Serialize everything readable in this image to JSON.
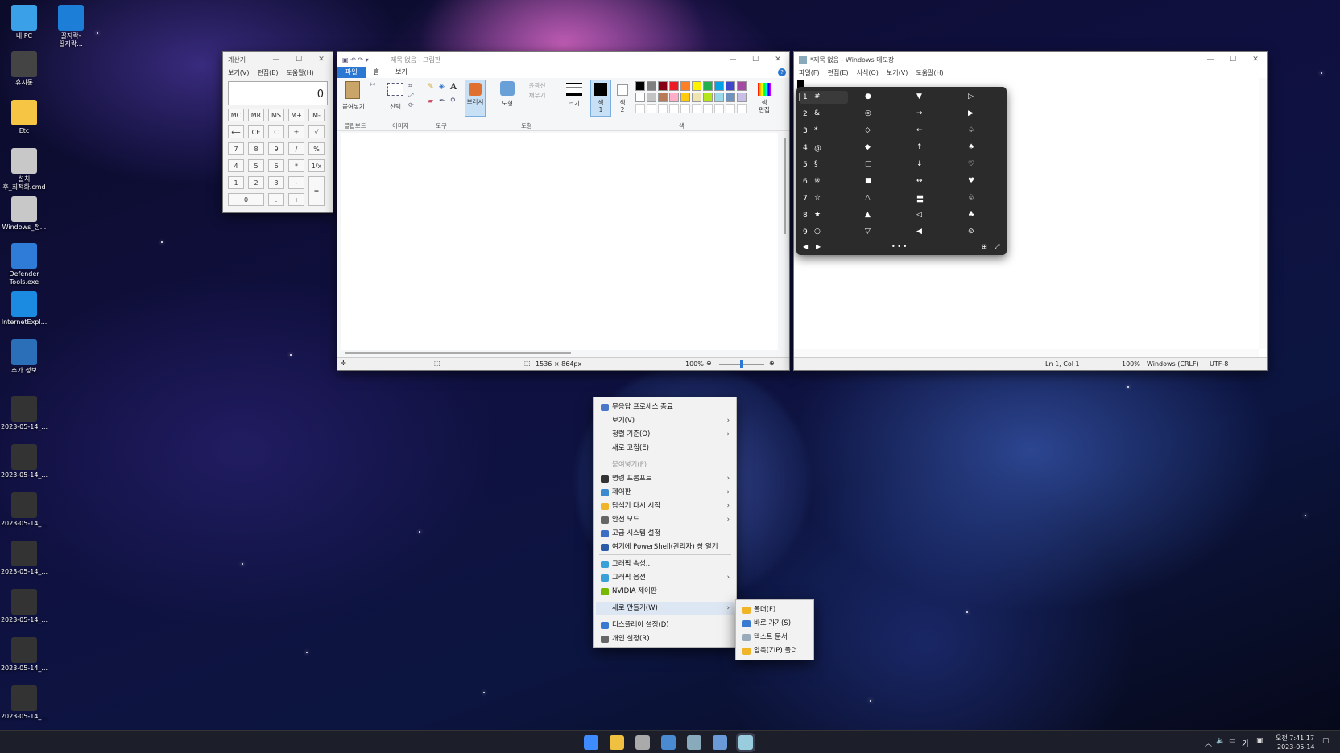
{
  "desktop": {
    "icons": [
      {
        "label": "내 PC",
        "color": "#3aa0e8"
      },
      {
        "label": "꿀지락-\n꿀지락...",
        "color": "#1c7ed6"
      },
      {
        "label": "휴지통",
        "color": "#444"
      },
      {
        "label": "Etc",
        "color": "#f6c543"
      },
      {
        "label": "설치\n후_최적화.cmd",
        "color": "#c8c8c8"
      },
      {
        "label": "Windows_정...",
        "color": "#c8c8c8"
      },
      {
        "label": "Defender\nTools.exe",
        "color": "#2f7bd8"
      },
      {
        "label": "InternetExpl...",
        "color": "#1a8be0"
      },
      {
        "label": "추가 정보",
        "color": "#2a6fb8"
      },
      {
        "label": "2023-05-14_...",
        "color": "#333"
      },
      {
        "label": "2023-05-14_...",
        "color": "#333"
      },
      {
        "label": "2023-05-14_...",
        "color": "#333"
      },
      {
        "label": "2023-05-14_...",
        "color": "#333"
      },
      {
        "label": "2023-05-14_...",
        "color": "#333"
      },
      {
        "label": "2023-05-14_...",
        "color": "#333"
      },
      {
        "label": "2023-05-14_...",
        "color": "#333"
      }
    ]
  },
  "calculator": {
    "title": "계산기",
    "menu": [
      "보기(V)",
      "편집(E)",
      "도움말(H)"
    ],
    "display": "0",
    "buttons": [
      "MC",
      "MR",
      "MS",
      "M+",
      "M-",
      "⟵",
      "CE",
      "C",
      "±",
      "√",
      "7",
      "8",
      "9",
      "/",
      "%",
      "4",
      "5",
      "6",
      "*",
      "1/x",
      "1",
      "2",
      "3",
      "-",
      "=",
      "0",
      ".",
      "+"
    ]
  },
  "paint": {
    "title": "제목 없음 - 그림판",
    "tabs": [
      "파일",
      "홈",
      "보기"
    ],
    "groups": [
      "클립보드",
      "이미지",
      "도구",
      "도형",
      "색"
    ],
    "labels": {
      "paste": "붙여넣기",
      "select": "선택",
      "brush": "브러시",
      "shapes": "도형",
      "outline": "윤곽선",
      "fill": "채우기",
      "size": "크기",
      "color1": "색\n1",
      "color2": "색\n2",
      "edit_colors": "색\n편집"
    },
    "palette": [
      "#000000",
      "#7f7f7f",
      "#880015",
      "#ed1c24",
      "#ff7f27",
      "#fff200",
      "#22b14c",
      "#00a2e8",
      "#3f48cc",
      "#a349a4",
      "#ffffff",
      "#c3c3c3",
      "#b97a57",
      "#ffaec9",
      "#ffc90e",
      "#efe4b0",
      "#b5e61d",
      "#99d9ea",
      "#7092be",
      "#c8bfe7"
    ],
    "status": {
      "size": "1536 × 864px",
      "zoom": "100%"
    }
  },
  "notepad": {
    "title": "*제목 없음 - Windows 메모장",
    "menu": [
      "파일(F)",
      "편집(E)",
      "서식(O)",
      "보기(V)",
      "도움말(H)"
    ],
    "status": {
      "pos": "Ln 1, Col 1",
      "zoom": "100%",
      "eol": "Windows (CRLF)",
      "enc": "UTF-8"
    }
  },
  "emoji": {
    "nums": [
      "1",
      "2",
      "3",
      "4",
      "5",
      "6",
      "7",
      "8",
      "9"
    ],
    "rows": [
      [
        "#",
        "●",
        "▼",
        "▷"
      ],
      [
        "&",
        "◎",
        "→",
        "▶"
      ],
      [
        "*",
        "◇",
        "←",
        "♤"
      ],
      [
        "＠",
        "◆",
        "↑",
        "♠"
      ],
      [
        "§",
        "□",
        "↓",
        "♡"
      ],
      [
        "※",
        "■",
        "↔",
        "♥"
      ],
      [
        "☆",
        "△",
        "〓",
        "♧"
      ],
      [
        "★",
        "▲",
        "◁",
        "♣"
      ],
      [
        "○",
        "▽",
        "◀",
        "⊙"
      ]
    ]
  },
  "context_menu": {
    "items": [
      {
        "label": "무응답 프로세스 종료",
        "icon": "#4a78c8",
        "arrow": false,
        "disabled": false
      },
      {
        "label": "보기(V)",
        "icon": "",
        "arrow": true,
        "disabled": false
      },
      {
        "label": "정렬 기준(O)",
        "icon": "",
        "arrow": true,
        "disabled": false
      },
      {
        "label": "새로 고침(E)",
        "icon": "",
        "arrow": false,
        "disabled": false
      },
      {
        "label": "붙여넣기(P)",
        "icon": "",
        "arrow": false,
        "disabled": true
      },
      {
        "label": "명령 프롬프트",
        "icon": "#333",
        "arrow": true,
        "disabled": false
      },
      {
        "label": "제어판",
        "icon": "#3a8ad0",
        "arrow": true,
        "disabled": false
      },
      {
        "label": "탐색기 다시 시작",
        "icon": "#f0b429",
        "arrow": true,
        "disabled": false
      },
      {
        "label": "안전 모드",
        "icon": "#666",
        "arrow": true,
        "disabled": false
      },
      {
        "label": "고급 시스템 설정",
        "icon": "#3b6fc4",
        "arrow": false,
        "disabled": false
      },
      {
        "label": "여기에 PowerShell(관리자) 창 열기",
        "icon": "#2a5aa8",
        "arrow": false,
        "disabled": false
      },
      {
        "label": "그래픽 속성...",
        "icon": "#3aa0d8",
        "arrow": false,
        "disabled": false
      },
      {
        "label": "그래픽 옵션",
        "icon": "#3aa0d8",
        "arrow": true,
        "disabled": false
      },
      {
        "label": "NVIDIA 제어판",
        "icon": "#76b900",
        "arrow": false,
        "disabled": false
      },
      {
        "label": "새로 만들기(W)",
        "icon": "",
        "arrow": true,
        "disabled": false
      },
      {
        "label": "디스플레이 설정(D)",
        "icon": "#3a7ad0",
        "arrow": false,
        "disabled": false
      },
      {
        "label": "개인 설정(R)",
        "icon": "#666",
        "arrow": false,
        "disabled": false
      }
    ]
  },
  "submenu": {
    "items": [
      {
        "label": "폴더(F)",
        "icon": "#f0b429"
      },
      {
        "label": "바로 가기(S)",
        "icon": "#3a7ad0"
      },
      {
        "label": "텍스트 문서",
        "icon": "#9ab"
      },
      {
        "label": "압축(ZIP) 폴더",
        "icon": "#f0b429"
      }
    ]
  },
  "taskbar": {
    "apps": [
      {
        "name": "start-icon",
        "color": "#3d8bfd"
      },
      {
        "name": "explorer-icon",
        "color": "#f0c040"
      },
      {
        "name": "settings-icon",
        "color": "#aaa"
      },
      {
        "name": "display-icon",
        "color": "#4a8ad0"
      },
      {
        "name": "notepad-icon",
        "color": "#8ab"
      },
      {
        "name": "paint-icon",
        "color": "#6a9ad8"
      },
      {
        "name": "calculator-icon",
        "color": "#9cd"
      }
    ],
    "tray": {
      "lang": "가",
      "time": "오전 7:41:17",
      "date": "2023-05-14"
    }
  }
}
